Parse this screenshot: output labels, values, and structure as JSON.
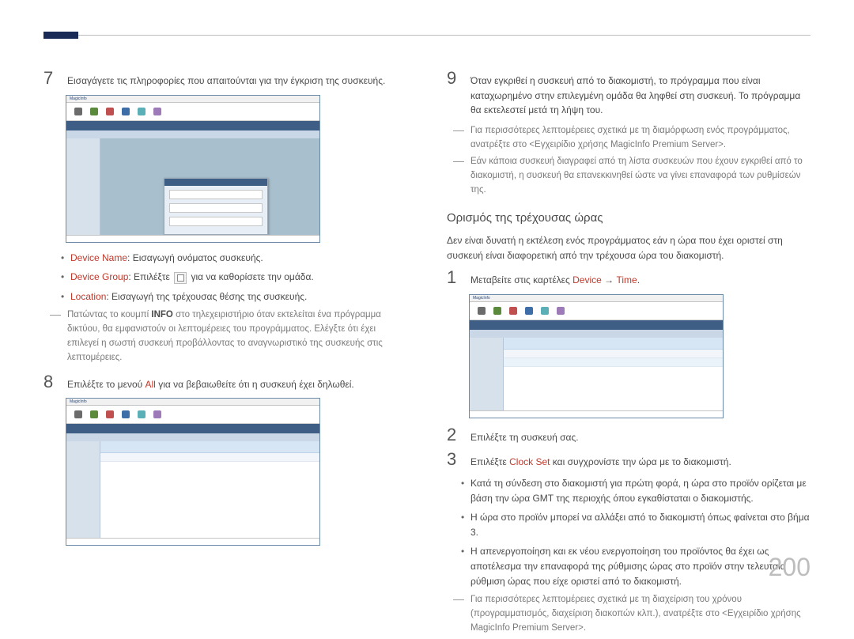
{
  "page_number": "200",
  "left": {
    "step7": "Εισαγάγετε τις πληροφορίες που απαιτούνται για την έγκριση της συσκευής.",
    "bullets": {
      "device_name_label": "Device Name",
      "device_name_text": ": Εισαγωγή ονόματος συσκευής.",
      "device_group_label": "Device Group",
      "device_group_text_a": ": Επιλέξτε ",
      "device_group_text_b": " για να καθορίσετε την ομάδα.",
      "location_label": "Location",
      "location_text": ": Εισαγωγή της τρέχουσας θέσης της συσκευής."
    },
    "note1a": "Πατώντας το κουμπί ",
    "note1_info": "INFO",
    "note1b": " στο τηλεχειριστήριο όταν εκτελείται ένα πρόγραμμα δικτύου, θα εμφανιστούν οι λεπτομέρειες του προγράμματος. Ελέγξτε ότι έχει επιλεγεί η σωστή συσκευή προβάλλοντας το αναγνωριστικό της συσκευής στις λεπτομέρειες.",
    "step8a": "Επιλέξτε το μενού ",
    "step8_all": "All",
    "step8b": " για να βεβαιωθείτε ότι η συσκευή έχει δηλωθεί."
  },
  "right": {
    "step9": "Όταν εγκριθεί η συσκευή από το διακομιστή, το πρόγραμμα που είναι καταχωρημένο στην επιλεγμένη ομάδα θα ληφθεί στη συσκευή. Το πρόγραμμα θα εκτελεστεί μετά τη λήψη του.",
    "note_r1": "Για περισσότερες λεπτομέρειες σχετικά με τη διαμόρφωση ενός προγράμματος, ανατρέξτε στο <Εγχειρίδιο χρήσης MagicInfo Premium Server>.",
    "note_r2": "Εάν κάποια συσκευή διαγραφεί από τη λίστα συσκευών που έχουν εγκριθεί από το διακομιστή, η συσκευή θα επανεκκινηθεί ώστε να γίνει επαναφορά των ρυθμίσεών της.",
    "heading": "Ορισμός της τρέχουσας ώρας",
    "intro": "Δεν είναι δυνατή η εκτέλεση ενός προγράμματος εάν η ώρα που έχει οριστεί στη συσκευή είναι διαφορετική από την τρέχουσα ώρα του διακομιστή.",
    "step1a": "Μεταβείτε στις καρτέλες ",
    "step1_device": "Device",
    "step1_arrow": " → ",
    "step1_time": "Time",
    "step1b": ".",
    "step2": "Επιλέξτε τη συσκευή σας.",
    "step3a": "Επιλέξτε ",
    "step3_clock": "Clock Set",
    "step3b": " και συγχρονίστε την ώρα με το διακομιστή.",
    "sub1": "Κατά τη σύνδεση στο διακομιστή για πρώτη φορά, η ώρα στο προϊόν ορίζεται με βάση την ώρα GMT της περιοχής όπου εγκαθίσταται ο διακομιστής.",
    "sub2": "Η ώρα στο προϊόν μπορεί να αλλάξει από το διακομιστή όπως φαίνεται στο βήμα 3.",
    "sub3": "Η απενεργοποίηση και εκ νέου ενεργοποίηση του προϊόντος θα έχει ως αποτέλεσμα την επαναφορά της ρύθμισης ώρας στο προϊόν στην τελευταία ρύθμιση ώρας που είχε οριστεί από το διακομιστή.",
    "note_r3": "Για περισσότερες λεπτομέρειες σχετικά με τη διαχείριση του χρόνου (προγραμματισμός, διαχείριση διακοπών κλπ.), ανατρέξτε στο <Εγχειρίδιο χρήσης MagicInfo Premium Server>."
  },
  "screenshot_label": "MagicInfo"
}
